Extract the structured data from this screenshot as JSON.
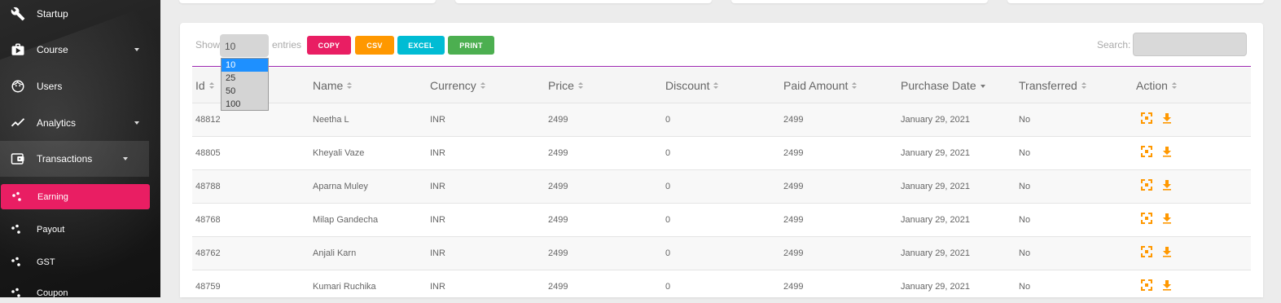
{
  "sidebar": {
    "items": [
      {
        "label": "Startup",
        "icon": "wrench-icon"
      },
      {
        "label": "Course",
        "icon": "briefcase-icon"
      },
      {
        "label": "Users",
        "icon": "face-icon"
      },
      {
        "label": "Analytics",
        "icon": "trending-icon"
      },
      {
        "label": "Transactions",
        "icon": "wallet-icon"
      }
    ],
    "subitems": [
      {
        "label": "Earning",
        "active": true
      },
      {
        "label": "Payout"
      },
      {
        "label": "GST"
      },
      {
        "label": "Coupon"
      }
    ]
  },
  "controls": {
    "show_label": "Show",
    "entries_label": "entries",
    "page_length": "10",
    "length_options": [
      "10",
      "25",
      "50",
      "100"
    ],
    "buttons": {
      "copy": "COPY",
      "csv": "CSV",
      "excel": "EXCEL",
      "print": "PRINT"
    },
    "search_label": "Search:",
    "search_value": ""
  },
  "colors": {
    "accent": "#e91e63",
    "copy": "#e91e63",
    "csv": "#ff9800",
    "excel": "#00bcd4",
    "print": "#4caf50",
    "header_line": "#9c27b0",
    "action_icon": "#ff9800"
  },
  "table": {
    "columns": [
      "Id",
      "Name",
      "Currency",
      "Price",
      "Discount",
      "Paid Amount",
      "Purchase Date",
      "Transferred",
      "Action"
    ],
    "sorted_column": "Purchase Date",
    "rows": [
      [
        "48812",
        "Neetha L",
        "INR",
        "2499",
        "0",
        "2499",
        "January 29, 2021",
        "No"
      ],
      [
        "48805",
        "Kheyali Vaze",
        "INR",
        "2499",
        "0",
        "2499",
        "January 29, 2021",
        "No"
      ],
      [
        "48788",
        "Aparna Muley",
        "INR",
        "2499",
        "0",
        "2499",
        "January 29, 2021",
        "No"
      ],
      [
        "48768",
        "Milap Gandecha",
        "INR",
        "2499",
        "0",
        "2499",
        "January 29, 2021",
        "No"
      ],
      [
        "48762",
        "Anjali Karn",
        "INR",
        "2499",
        "0",
        "2499",
        "January 29, 2021",
        "No"
      ],
      [
        "48759",
        "Kumari Ruchika",
        "INR",
        "2499",
        "0",
        "2499",
        "January 29, 2021",
        "No"
      ]
    ],
    "row_actions": [
      "expand-icon",
      "download-icon"
    ]
  }
}
